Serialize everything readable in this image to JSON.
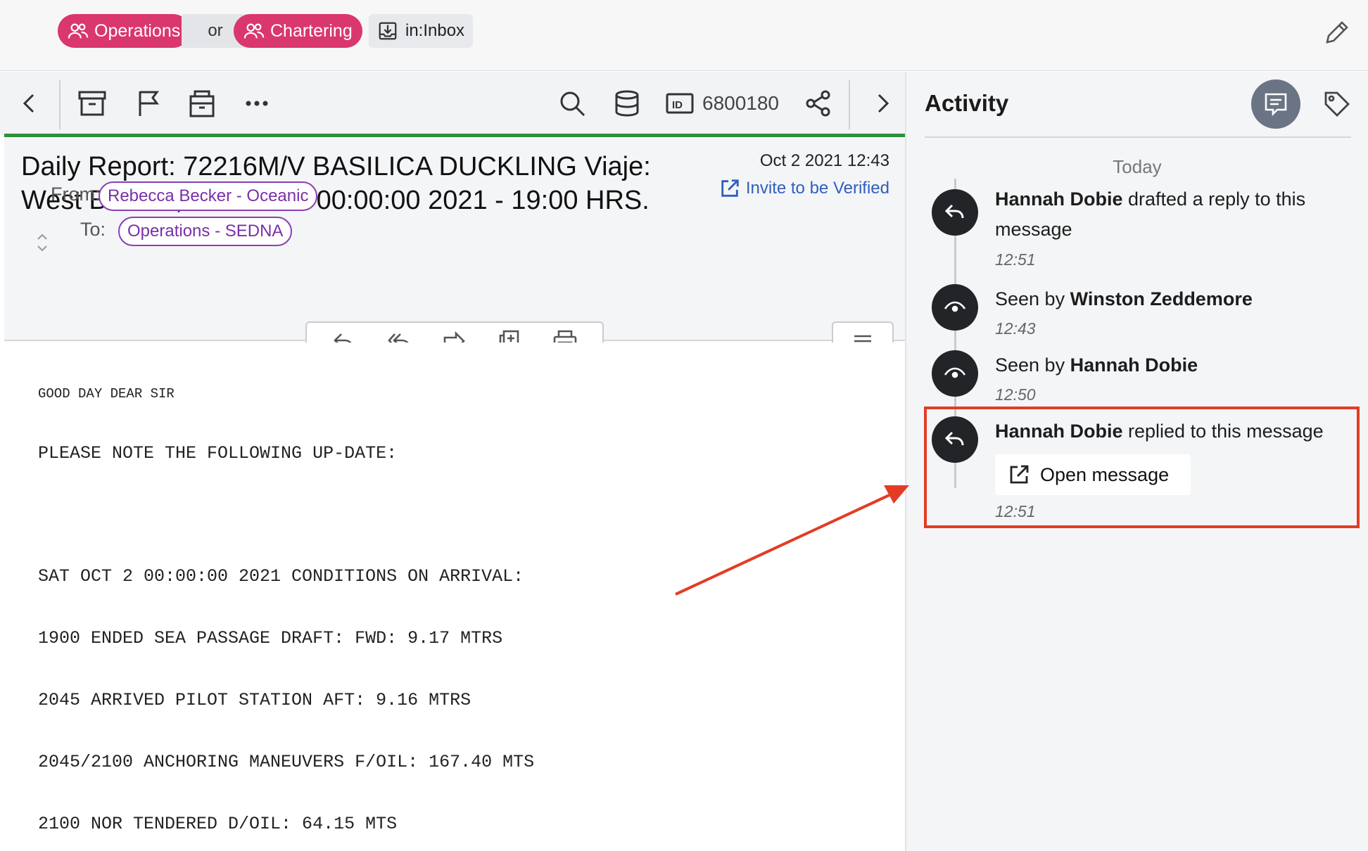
{
  "filters": {
    "tag_operations": "Operations",
    "join_word": "or",
    "tag_chartering": "Chartering",
    "folder_chip": "in:Inbox"
  },
  "toolbar": {
    "message_id": "6800180"
  },
  "message": {
    "subject_line1": "Daily Report: 72216M/V BASILICA DUCKLING Viaje:",
    "subject_line2": "West Brenda, Sat Oct  2 00:00:00 2021 - 19:00 HRS.",
    "date": "Oct 2 2021 12:43",
    "verify_link": "Invite to be Verified",
    "from_label": "From:",
    "from_value": "Rebecca Becker - Oceanic",
    "to_label": "To:",
    "to_value": "Operations - SEDNA",
    "body": [
      "GOOD DAY DEAR SIR",
      "PLEASE NOTE THE FOLLOWING UP-DATE:",
      "SAT OCT 2 00:00:00 2021 CONDITIONS ON ARRIVAL:",
      "1900 ENDED SEA PASSAGE DRAFT: FWD: 9.17 MTRS",
      "2045 ARRIVED PILOT STATION AFT: 9.16 MTRS",
      "2045/2100 ANCHORING MANEUVERS F/OIL: 167.40 MTS",
      "2100 NOR TENDERED D/OIL: 64.15 MTS"
    ]
  },
  "activity": {
    "title": "Activity",
    "day_label": "Today",
    "events": [
      {
        "actor": "Hannah Dobie",
        "action": " drafted a reply to this message",
        "time": "12:51"
      },
      {
        "prefix": "Seen by ",
        "actor": "Winston Zeddemore",
        "time": "12:43"
      },
      {
        "prefix": "Seen by ",
        "actor": "Hannah Dobie",
        "time": "12:50"
      },
      {
        "actor": "Hannah Dobie",
        "action": " replied to this message",
        "button": "Open message",
        "time": "12:51"
      }
    ]
  },
  "colors": {
    "tag_pink": "#d9376e",
    "address_purple": "#8a3fb3",
    "link_blue": "#2f5fbf",
    "status_green": "#2f8f3c",
    "annotation_red": "#e33c24"
  }
}
